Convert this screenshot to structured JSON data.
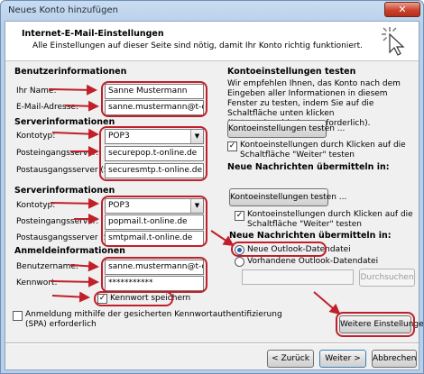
{
  "window": {
    "title": "Neues Konto hinzufügen",
    "close_glyph": "✕"
  },
  "header": {
    "title": "Internet-E-Mail-Einstellungen",
    "subtitle": "Alle Einstellungen auf dieser Seite sind nötig, damit Ihr Konto richtig funktioniert."
  },
  "user_info": {
    "heading": "Benutzerinformationen",
    "name_label": "Ihr Name:",
    "name_value": "Sanne Mustermann",
    "email_label": "E-Mail-Adresse:",
    "email_value": "sanne.mustermann@t-online.c"
  },
  "server_info_1": {
    "heading": "Serverinformationen",
    "type_label": "Kontotyp:",
    "type_value": "POP3",
    "incoming_label": "Posteingangsserver:",
    "incoming_value": "securepop.t-online.de",
    "outgoing_label": "Postausgangsserver (SMTP):",
    "outgoing_value": "securesmtp.t-online.de"
  },
  "server_info_2": {
    "heading": "Serverinformationen",
    "type_label": "Kontotyp:",
    "type_value": "POP3",
    "incoming_label": "Posteingangsserver:",
    "incoming_value": "popmail.t-online.de",
    "outgoing_label": "Postausgangsserver (SMTP):",
    "outgoing_value": "smtpmail.t-online.de"
  },
  "logon_info": {
    "heading": "Anmeldeinformationen",
    "user_label": "Benutzername:",
    "user_value": "sanne.mustermann@t-online.c",
    "password_label": "Kennwort:",
    "password_value": "***********",
    "remember_label": "Kennwort speichern",
    "spa_label_1": "Anmeldung mithilfe der gesicherten Kennwortauthentifizierung",
    "spa_label_2": "(SPA) erforderlich"
  },
  "test_settings": {
    "heading": "Kontoeinstellungen testen",
    "description": "Wir empfehlen Ihnen, das Konto nach dem Eingeben aller Informationen in diesem Fenster zu testen, indem Sie auf die Schaltfläche unten klicken (Netzwerkverbindung erforderlich).",
    "test_button_1": "Kontoeinstellungen testen ...",
    "test_checkbox_1a": "Kontoeinstellungen durch Klicken auf die",
    "test_checkbox_1b": "Schaltfläche \"Weiter\" testen",
    "deliver_heading_1": "Neue Nachrichten übermitteln in:",
    "test_button_2": "Kontoeinstellungen testen ...",
    "test_checkbox_2a": "Kontoeinstellungen durch Klicken auf die",
    "test_checkbox_2b": "Schaltfläche \"Weiter\" testen",
    "deliver_heading_2": "Neue Nachrichten übermitteln in:",
    "radio_new": "Neue Outlook-Datendatei",
    "radio_existing": "Vorhandene Outlook-Datendatei",
    "browse_button": "Durchsuchen",
    "more_settings_button": "Weitere Einstellungen"
  },
  "footer": {
    "back_button": "< Zurück",
    "next_button": "Weiter >",
    "cancel_button": "Abbrechen"
  },
  "colors": {
    "annotation": "#c0202a",
    "titlebar": "#b7cfe9"
  }
}
